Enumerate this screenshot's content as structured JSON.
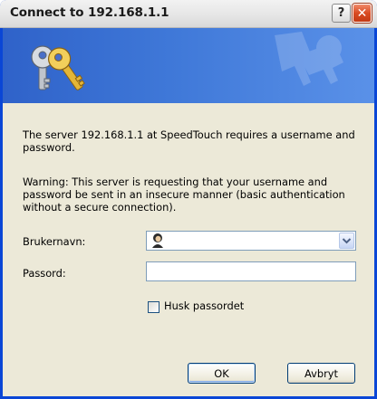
{
  "window": {
    "title": "Connect to 192.168.1.1",
    "help_label": "?",
    "close_label": "✕"
  },
  "banner": {
    "icon": "keys-icon",
    "watermark": "keys-watermark-icon"
  },
  "message": {
    "line1": "The server 192.168.1.1 at SpeedTouch requires a username and password.",
    "warning": "Warning: This server is requesting that your username and password be sent in an insecure manner (basic authentication without a secure connection)."
  },
  "form": {
    "username_label": "Brukernavn:",
    "username_value": "",
    "password_label": "Passord:",
    "password_value": "",
    "remember_label": "Husk passordet",
    "remember_checked": false
  },
  "buttons": {
    "ok": "OK",
    "cancel": "Avbryt"
  },
  "colors": {
    "titlebar": "#e6e6e6",
    "banner": "#3f78d8",
    "dialog_bg": "#ece9d8",
    "close_button": "#d94b22"
  }
}
